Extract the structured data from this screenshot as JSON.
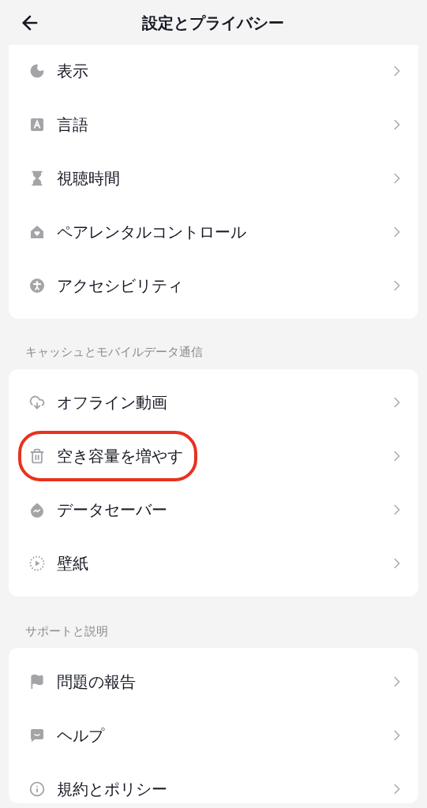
{
  "header": {
    "title": "設定とプライバシー"
  },
  "sections": [
    {
      "items": [
        {
          "label": "表示",
          "highlighted": false
        },
        {
          "label": "言語",
          "highlighted": false
        },
        {
          "label": "視聴時間",
          "highlighted": false
        },
        {
          "label": "ペアレンタルコントロール",
          "highlighted": false
        },
        {
          "label": "アクセシビリティ",
          "highlighted": false
        }
      ]
    },
    {
      "title": "キャッシュとモバイルデータ通信",
      "items": [
        {
          "label": "オフライン動画",
          "highlighted": false
        },
        {
          "label": "空き容量を増やす",
          "highlighted": true
        },
        {
          "label": "データセーバー",
          "highlighted": false
        },
        {
          "label": "壁紙",
          "highlighted": false
        }
      ]
    },
    {
      "title": "サポートと説明",
      "items": [
        {
          "label": "問題の報告",
          "highlighted": false
        },
        {
          "label": "ヘルプ",
          "highlighted": false
        },
        {
          "label": "規約とポリシー",
          "highlighted": false
        }
      ]
    }
  ]
}
